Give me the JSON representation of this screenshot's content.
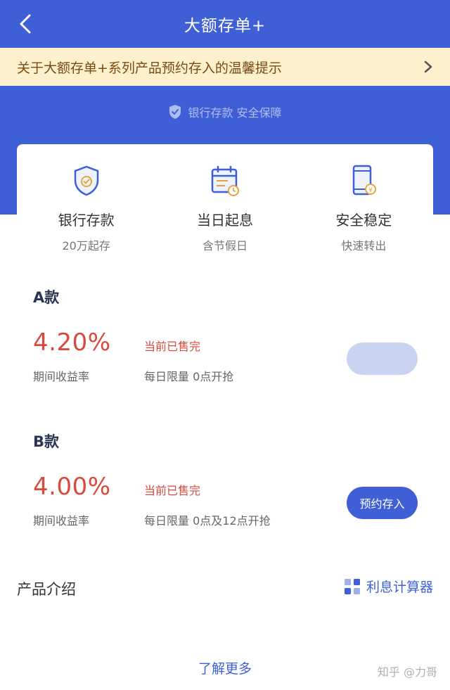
{
  "header": {
    "title": "大额存单+"
  },
  "notice": {
    "text": "关于大额存单+系列产品预约存入的温馨提示"
  },
  "safety": {
    "text": "银行存款 安全保障"
  },
  "features": [
    {
      "title": "银行存款",
      "sub": "20万起存",
      "icon": "shield-icon"
    },
    {
      "title": "当日起息",
      "sub": "含节假日",
      "icon": "calendar-icon"
    },
    {
      "title": "安全稳定",
      "sub": "快速转出",
      "icon": "phone-icon"
    }
  ],
  "products": [
    {
      "name": "A款",
      "rate": "4.20%",
      "rate_label": "期间收益率",
      "status": "当前已售完",
      "limit": "每日限量  0点开抢",
      "button": "",
      "button_state": "disabled"
    },
    {
      "name": "B款",
      "rate": "4.00%",
      "rate_label": "期间收益率",
      "status": "当前已售完",
      "limit": "每日限量 0点及12点开抢",
      "button": "预约存入",
      "button_state": "active"
    }
  ],
  "section": {
    "title": "产品介绍",
    "calculator": "利息计算器"
  },
  "learn_more": "了解更多",
  "watermark": "知乎 @力哥",
  "colors": {
    "brand": "#3f5fd6",
    "rate": "#d84a3c",
    "notice_bg": "#fdf0cc"
  }
}
